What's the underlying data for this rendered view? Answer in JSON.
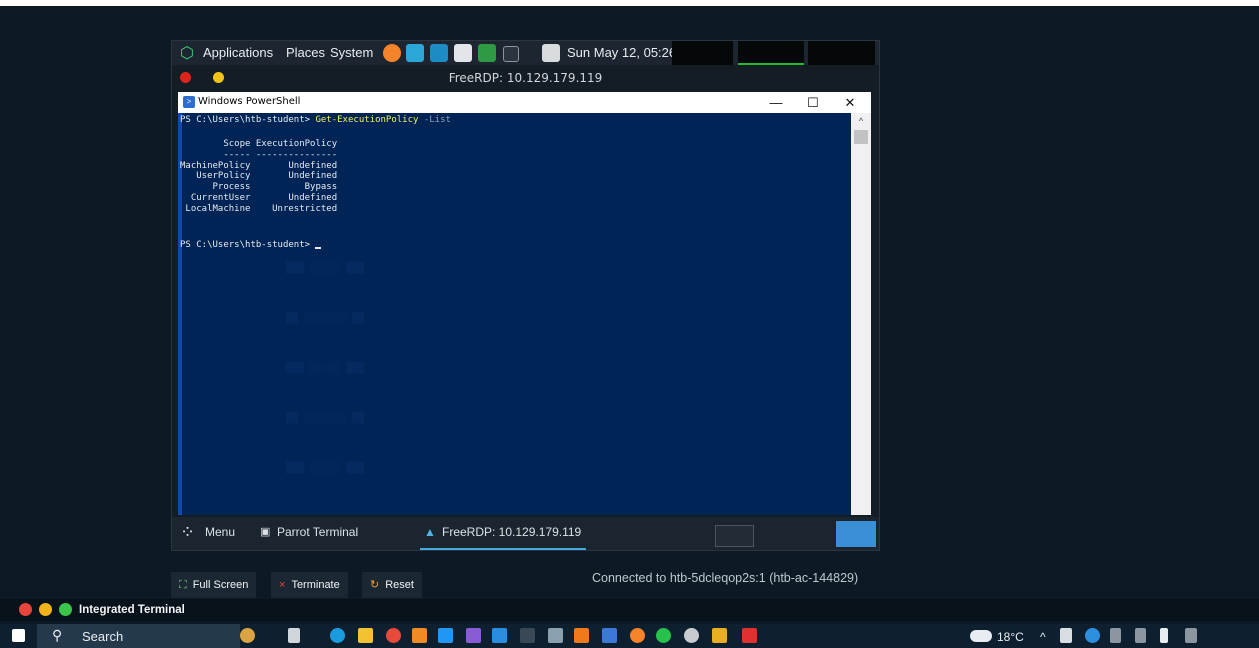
{
  "parrot_top_panel": {
    "menus": [
      "Applications",
      "Places",
      "System"
    ],
    "clock": "Sun May 12, 05:26",
    "accent_green": "#1fb92b"
  },
  "window_title": "FreeRDP: 10.129.179.119",
  "powershell": {
    "title": "Windows PowerShell",
    "minimize_glyph": "—",
    "maximize_glyph": "☐",
    "close_glyph": "✕",
    "scroll_up_glyph": "^",
    "prompt": "PS C:\\Users\\htb-student> ",
    "command": "Get-ExecutionPolicy",
    "argument": " -List",
    "header_line": "        Scope ExecutionPolicy",
    "separator_line": "        ----- ---------------",
    "rows": [
      "MachinePolicy       Undefined",
      "   UserPolicy       Undefined",
      "      Process          Bypass",
      "  CurrentUser       Undefined",
      " LocalMachine    Unrestricted"
    ],
    "final_prompt": "PS C:\\Users\\htb-student> ",
    "background": "#012456",
    "command_color": "#f6f25d"
  },
  "parrot_bottom_panel": {
    "menu_label": "Menu",
    "task1": "Parrot Terminal",
    "task2": "FreeRDP: 10.129.179.119"
  },
  "guac_toolbar": {
    "fullscreen": "Full Screen",
    "terminate": "Terminate",
    "reset": "Reset",
    "connected_text": "Connected to htb-5dcleqop2s:1 (htb-ac-144829)"
  },
  "integrated_terminal": {
    "label": "Integrated Terminal",
    "colors": [
      "#e8453c",
      "#f3b41b",
      "#3cc54b"
    ]
  },
  "taskbar": {
    "search_placeholder": "Search",
    "temperature": "18°C",
    "caret": "^"
  }
}
